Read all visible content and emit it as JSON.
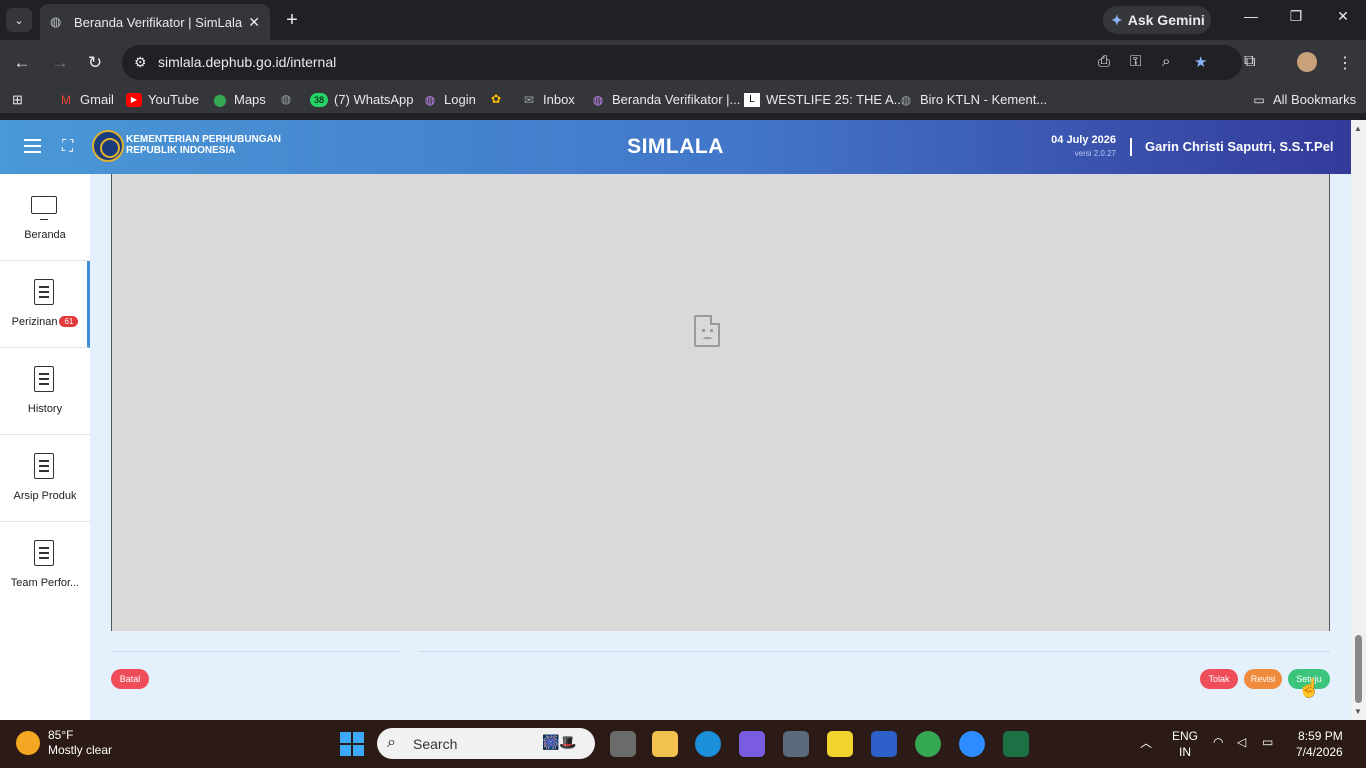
{
  "browser": {
    "tab_title": "Beranda Verifikator | SimLala",
    "ask_gemini": "Ask Gemini",
    "url": "simlala.dephub.go.id/internal",
    "bookmarks": [
      {
        "label": "Gmail",
        "icon": "gmail-icon",
        "color": "#ea4335"
      },
      {
        "label": "YouTube",
        "icon": "youtube-icon",
        "color": "#ff0000"
      },
      {
        "label": "Maps",
        "icon": "maps-icon",
        "color": "#34a853"
      },
      {
        "label": "",
        "icon": "globe-icon",
        "color": "#9aa0a6"
      },
      {
        "label": "(7) WhatsApp",
        "icon": "whatsapp-icon",
        "color": "#25d366",
        "badge": "38"
      },
      {
        "label": "Login",
        "icon": "globe-icon",
        "color": "#c58af9"
      },
      {
        "label": "",
        "icon": "pinwheel-icon",
        "color": "#fbbc04"
      },
      {
        "label": "Inbox",
        "icon": "mail-icon",
        "color": "#9aa0a6"
      },
      {
        "label": "Beranda Verifikator |...",
        "icon": "globe-icon",
        "color": "#c58af9"
      },
      {
        "label": "WESTLIFE 25: THE A...",
        "icon": "l-icon",
        "color": "#ffffff"
      },
      {
        "label": "Biro KTLN - Kement...",
        "icon": "globe-icon",
        "color": "#9aa0a6"
      }
    ],
    "all_bookmarks": "All Bookmarks"
  },
  "app": {
    "ministry_line1": "KEMENTERIAN PERHUBUNGAN",
    "ministry_line2": "REPUBLIK INDONESIA",
    "title": "SIMLALA",
    "date": "04 July 2026",
    "version": "versi 2.0.27",
    "user": "Garin Christi Saputri, S.S.T.Pel",
    "sidebar": [
      {
        "label": "Beranda",
        "icon": "monitor-icon"
      },
      {
        "label": "Perizinan",
        "icon": "document-icon",
        "badge": "61"
      },
      {
        "label": "History",
        "icon": "document-icon"
      },
      {
        "label": "Arsip Produk",
        "icon": "document-icon"
      },
      {
        "label": "Team Perfor...",
        "icon": "document-icon"
      }
    ],
    "buttons": {
      "batal": "Batal",
      "tolak": "Tolak",
      "revisi": "Revisi",
      "setuju": "Setuju"
    },
    "colors": {
      "batal": "#ef4d5a",
      "tolak": "#ef4d5a",
      "revisi": "#f08a3c",
      "setuju": "#3cc47c"
    }
  },
  "taskbar": {
    "temperature": "85°F",
    "condition": "Mostly clear",
    "search_placeholder": "Search",
    "lang1": "ENG",
    "lang2": "IN",
    "time": "8:59 PM",
    "date": "7/4/2026"
  }
}
